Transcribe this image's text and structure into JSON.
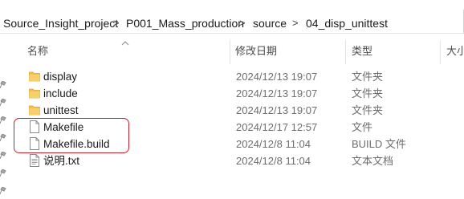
{
  "breadcrumb": {
    "items": [
      {
        "label": "Source_Insight_project"
      },
      {
        "label": "P001_Mass_production"
      },
      {
        "label": "source"
      },
      {
        "label": "04_disp_unittest"
      }
    ],
    "separator": ">"
  },
  "columns": {
    "name": "名称",
    "date": "修改日期",
    "type": "类型",
    "size": "大小"
  },
  "files": [
    {
      "name": "display",
      "date": "2024/12/13 19:07",
      "type": "文件夹",
      "icon": "folder-icon"
    },
    {
      "name": "include",
      "date": "2024/12/13 19:07",
      "type": "文件夹",
      "icon": "folder-icon"
    },
    {
      "name": "unittest",
      "date": "2024/12/13 19:07",
      "type": "文件夹",
      "icon": "folder-icon"
    },
    {
      "name": "Makefile",
      "date": "2024/12/17 12:57",
      "type": "文件",
      "icon": "file-icon"
    },
    {
      "name": "Makefile.build",
      "date": "2024/12/8 11:04",
      "type": "BUILD 文件",
      "icon": "file-icon"
    },
    {
      "name": "说明.txt",
      "date": "2024/12/8 11:04",
      "type": "文本文档",
      "icon": "text-file-icon"
    }
  ],
  "colors": {
    "folder": "#f4c04a",
    "highlight": "#c8202a"
  }
}
